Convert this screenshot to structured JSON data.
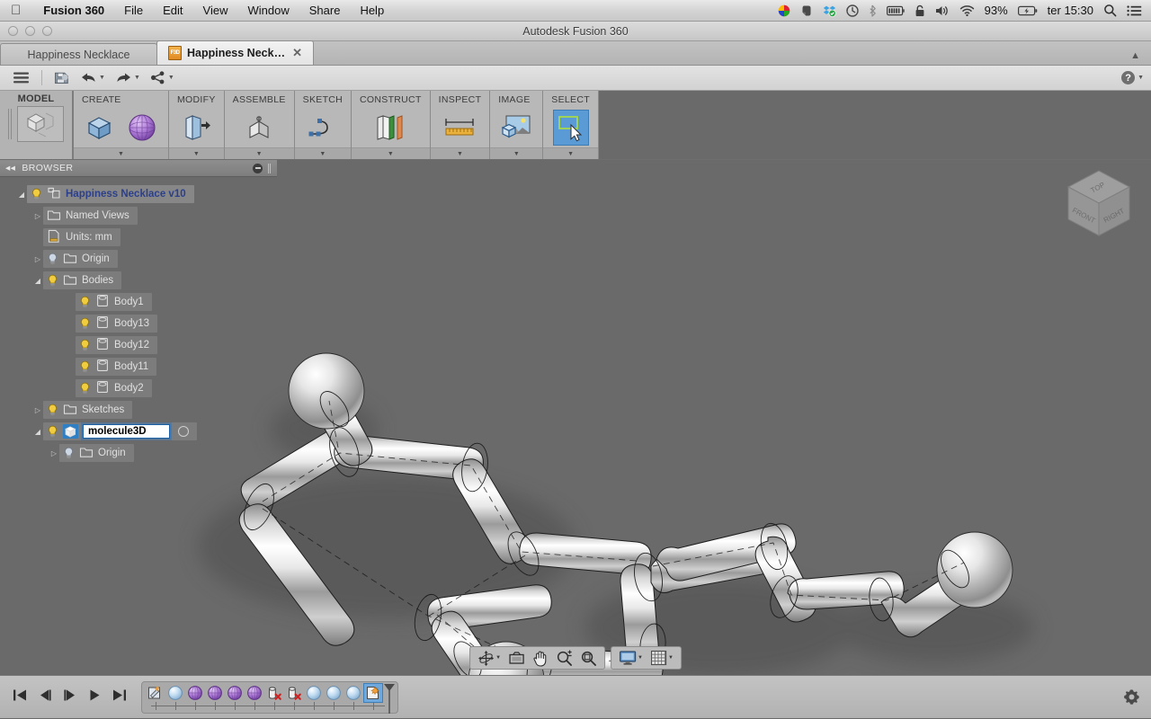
{
  "macos": {
    "apple_icon": "apple-logo-icon",
    "app_name": "Fusion 360",
    "menus": [
      "File",
      "Edit",
      "View",
      "Window",
      "Share",
      "Help"
    ],
    "status_icons": [
      "colorsync-icon",
      "evernote-icon",
      "dropbox-icon",
      "timemachine-icon",
      "bluetooth-icon",
      "battery-meter-icon",
      "lock-icon",
      "volume-icon",
      "wifi-icon"
    ],
    "battery_percent": "93%",
    "battery_icon": "battery-charging-icon",
    "clock": "ter 15:30",
    "spotlight_icon": "search-icon",
    "notification_icon": "notification-center-icon"
  },
  "window": {
    "title": "Autodesk Fusion 360",
    "close_label": "close",
    "minimize_label": "minimize",
    "zoom_label": "zoom"
  },
  "tabs": {
    "items": [
      {
        "label": "Happiness Necklace",
        "active": false,
        "has_icon": false,
        "closable": false
      },
      {
        "label": "Happiness Neckl...",
        "active": true,
        "has_icon": true,
        "icon": "f3d-file-icon",
        "file_badge": "F3D",
        "closable": true,
        "close_icon": "close-icon"
      }
    ],
    "collapse_icon": "chevron-up-icon"
  },
  "quick_access": {
    "items": [
      {
        "name": "application-menu",
        "icon": "hamburger-icon",
        "caret": false
      },
      {
        "name": "save",
        "icon": "save-disk-icon",
        "caret": false
      },
      {
        "name": "undo",
        "icon": "undo-arrow-icon",
        "caret": true
      },
      {
        "name": "redo",
        "icon": "redo-arrow-icon",
        "caret": true
      },
      {
        "name": "share",
        "icon": "share-nodes-icon",
        "caret": true
      }
    ],
    "help_label": "?",
    "help_caret": "chevron-down-icon"
  },
  "ribbon": {
    "workspace": {
      "label": "MODEL",
      "icon": "model-workspace-cube-icon"
    },
    "panels": [
      {
        "title": "CREATE",
        "tools": [
          {
            "name": "create-box-tool",
            "icon": "blue-box-icon"
          },
          {
            "name": "create-sphere-tool",
            "icon": "purple-sphere-icon"
          }
        ],
        "dropdown": true
      },
      {
        "title": "MODIFY",
        "tools": [
          {
            "name": "modify-press-pull-tool",
            "icon": "press-pull-icon"
          }
        ],
        "dropdown": true
      },
      {
        "title": "ASSEMBLE",
        "tools": [
          {
            "name": "assemble-joint-tool",
            "icon": "joint-icon"
          }
        ],
        "dropdown": true
      },
      {
        "title": "SKETCH",
        "tools": [
          {
            "name": "sketch-spline-tool",
            "icon": "spline-curve-icon"
          }
        ],
        "dropdown": true
      },
      {
        "title": "CONSTRUCT",
        "tools": [
          {
            "name": "construct-plane-tool",
            "icon": "offset-plane-icon"
          }
        ],
        "dropdown": true
      },
      {
        "title": "INSPECT",
        "tools": [
          {
            "name": "inspect-measure-tool",
            "icon": "ruler-measure-icon"
          }
        ],
        "dropdown": true
      },
      {
        "title": "IMAGE",
        "tools": [
          {
            "name": "image-capture-tool",
            "icon": "canvas-image-icon"
          }
        ],
        "dropdown": true
      },
      {
        "title": "SELECT",
        "tools": [
          {
            "name": "select-tool",
            "icon": "selection-arrow-icon",
            "selected": true
          }
        ],
        "dropdown": true
      }
    ]
  },
  "browser": {
    "header": "BROWSER",
    "collapse_icon": "double-chevron-left-icon",
    "minus_icon": "circle-minus-icon",
    "grip_icon": "panel-grip-icon",
    "tree": [
      {
        "label": "Happiness Necklace v10",
        "indent": 0,
        "arrow": "open",
        "bulb": "on",
        "icon": "document-component-icon",
        "root": true
      },
      {
        "label": "Named Views",
        "indent": 1,
        "arrow": "closed",
        "bulb": "none",
        "icon": "folder-icon"
      },
      {
        "label": "Units: mm",
        "indent": 1,
        "arrow": "none",
        "bulb": "none",
        "icon": "units-document-icon"
      },
      {
        "label": "Origin",
        "indent": 1,
        "arrow": "closed",
        "bulb": "off",
        "icon": "folder-icon"
      },
      {
        "label": "Bodies",
        "indent": 1,
        "arrow": "open",
        "bulb": "on",
        "icon": "folder-icon"
      },
      {
        "label": "Body1",
        "indent": 2,
        "arrow": "none",
        "bulb": "on",
        "icon": "body-cylinder-icon"
      },
      {
        "label": "Body13",
        "indent": 2,
        "arrow": "none",
        "bulb": "on",
        "icon": "body-cylinder-icon"
      },
      {
        "label": "Body12",
        "indent": 2,
        "arrow": "none",
        "bulb": "on",
        "icon": "body-cylinder-icon"
      },
      {
        "label": "Body11",
        "indent": 2,
        "arrow": "none",
        "bulb": "on",
        "icon": "body-cylinder-icon"
      },
      {
        "label": "Body2",
        "indent": 2,
        "arrow": "none",
        "bulb": "on",
        "icon": "body-cylinder-icon"
      },
      {
        "label": "Sketches",
        "indent": 1,
        "arrow": "closed",
        "bulb": "on",
        "icon": "folder-icon"
      },
      {
        "label": "molecule3D",
        "indent": 1,
        "arrow": "open",
        "bulb": "on",
        "icon": "component-icon",
        "editing": true,
        "radio": true
      },
      {
        "label": "Origin",
        "indent": 2,
        "arrow": "closed",
        "bulb": "off",
        "icon": "folder-icon"
      }
    ]
  },
  "viewcube": {
    "top_face": "TOP",
    "front_face": "FRONT",
    "right_face": "RIGHT"
  },
  "navbar": {
    "group1": [
      {
        "name": "orbit-tool",
        "icon": "orbit-icon",
        "caret": true
      },
      {
        "name": "look-at-tool",
        "icon": "look-at-icon",
        "caret": false
      },
      {
        "name": "pan-tool",
        "icon": "hand-pan-icon",
        "caret": false
      },
      {
        "name": "zoom-tool",
        "icon": "zoom-magnifier-icon",
        "caret": false
      },
      {
        "name": "fit-tool",
        "icon": "zoom-fit-icon",
        "caret": false
      }
    ],
    "group2": [
      {
        "name": "display-settings",
        "icon": "monitor-display-icon",
        "caret": true
      },
      {
        "name": "grid-settings",
        "icon": "grid-snap-icon",
        "caret": true
      }
    ]
  },
  "timeline": {
    "playback": [
      {
        "name": "go-to-beginning",
        "icon": "skip-start-icon"
      },
      {
        "name": "step-back",
        "icon": "step-back-icon"
      },
      {
        "name": "step-forward",
        "icon": "step-forward-icon"
      },
      {
        "name": "play",
        "icon": "play-icon"
      },
      {
        "name": "go-to-end",
        "icon": "skip-end-icon"
      }
    ],
    "features": [
      {
        "name": "sketch-feature",
        "icon": "sketch-feature-icon",
        "selected": false
      },
      {
        "name": "sphere-feature-1",
        "icon": "blue-sphere-icon",
        "selected": false
      },
      {
        "name": "sphere-feature-2",
        "icon": "purple-sphere-icon",
        "selected": false
      },
      {
        "name": "sphere-feature-3",
        "icon": "purple-sphere-icon",
        "selected": false
      },
      {
        "name": "sphere-feature-4",
        "icon": "purple-sphere-icon",
        "selected": false
      },
      {
        "name": "sphere-feature-5",
        "icon": "purple-sphere-icon",
        "selected": false
      },
      {
        "name": "cut-feature-1",
        "icon": "cylinder-cut-icon",
        "selected": false
      },
      {
        "name": "cut-feature-2",
        "icon": "cylinder-cut-icon",
        "selected": false
      },
      {
        "name": "sphere-feature-6",
        "icon": "blue-sphere-icon",
        "selected": false
      },
      {
        "name": "sphere-feature-7",
        "icon": "blue-sphere-icon",
        "selected": false
      },
      {
        "name": "sphere-feature-8",
        "icon": "blue-sphere-icon",
        "selected": false
      },
      {
        "name": "sketch-feature-2",
        "icon": "sketch-feature-icon",
        "selected": true
      }
    ],
    "marker_icon": "timeline-marker-icon",
    "settings_icon": "gear-icon"
  },
  "colors": {
    "canvas_bg": "#6a6a6a",
    "ribbon_bg": "#9e9e9e",
    "panel_bg": "#b8b8b8",
    "accent_blue": "#2f7fc4",
    "tree_highlight": "#2b3f8c",
    "model_chrome": "#d8d8d8",
    "timeline_bg": "#bababa"
  }
}
